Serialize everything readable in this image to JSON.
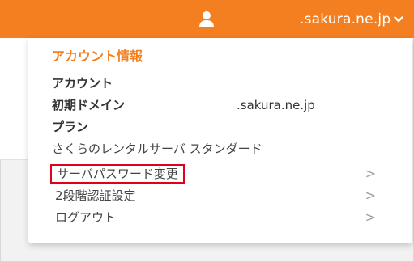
{
  "header": {
    "user_icon": "user-icon",
    "domain": ".sakura.ne.jp",
    "dropdown_icon": "chevron-down-icon",
    "colors": {
      "bar": "#f47f20"
    }
  },
  "panel": {
    "title": "アカウント情報",
    "account_label": "アカウント",
    "domain_label": "初期ドメイン",
    "domain_value": ".sakura.ne.jp",
    "plan_label": "プラン",
    "plan_value": "さくらのレンタルサーバ スタンダード",
    "menu": [
      {
        "label": "サーバパスワード変更",
        "arrow": ">"
      },
      {
        "label": "2段階認証設定",
        "arrow": ">"
      },
      {
        "label": "ログアウト",
        "arrow": ">"
      }
    ],
    "highlight_color": "#e0001b"
  }
}
